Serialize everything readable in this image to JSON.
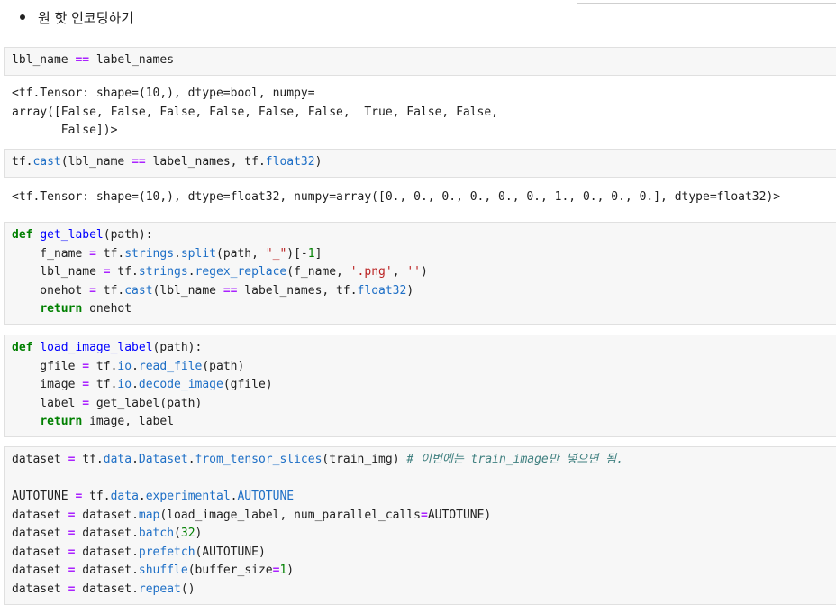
{
  "bullet": {
    "text": "원 핫 인코딩하기"
  },
  "cells": [
    {
      "lines": [
        [
          [
            "t",
            "lbl_name "
          ],
          [
            "op",
            "=="
          ],
          [
            "t",
            " label_names"
          ]
        ]
      ]
    },
    {
      "lines": [
        [
          [
            "t",
            "tf."
          ],
          [
            "attr",
            "cast"
          ],
          [
            "t",
            "(lbl_name "
          ],
          [
            "op",
            "=="
          ],
          [
            "t",
            " label_names, tf."
          ],
          [
            "attr",
            "float32"
          ],
          [
            "t",
            ")"
          ]
        ]
      ]
    },
    {
      "lines": [
        [
          [
            "kw",
            "def"
          ],
          [
            "t",
            " "
          ],
          [
            "fn",
            "get_label"
          ],
          [
            "t",
            "(path):"
          ]
        ],
        [
          [
            "t",
            "    f_name "
          ],
          [
            "op",
            "="
          ],
          [
            "t",
            " tf."
          ],
          [
            "attr",
            "strings"
          ],
          [
            "t",
            "."
          ],
          [
            "attr",
            "split"
          ],
          [
            "t",
            "(path, "
          ],
          [
            "str",
            "\"_\""
          ],
          [
            "t",
            ")[-"
          ],
          [
            "num",
            "1"
          ],
          [
            "t",
            "]"
          ]
        ],
        [
          [
            "t",
            "    lbl_name "
          ],
          [
            "op",
            "="
          ],
          [
            "t",
            " tf."
          ],
          [
            "attr",
            "strings"
          ],
          [
            "t",
            "."
          ],
          [
            "attr",
            "regex_replace"
          ],
          [
            "t",
            "(f_name, "
          ],
          [
            "str",
            "'.png'"
          ],
          [
            "t",
            ", "
          ],
          [
            "str",
            "''"
          ],
          [
            "t",
            ")"
          ]
        ],
        [
          [
            "t",
            "    onehot "
          ],
          [
            "op",
            "="
          ],
          [
            "t",
            " tf."
          ],
          [
            "attr",
            "cast"
          ],
          [
            "t",
            "(lbl_name "
          ],
          [
            "op",
            "=="
          ],
          [
            "t",
            " label_names, tf."
          ],
          [
            "attr",
            "float32"
          ],
          [
            "t",
            ")"
          ]
        ],
        [
          [
            "t",
            "    "
          ],
          [
            "kw",
            "return"
          ],
          [
            "t",
            " onehot"
          ]
        ]
      ]
    },
    {
      "lines": [
        [
          [
            "kw",
            "def"
          ],
          [
            "t",
            " "
          ],
          [
            "fn",
            "load_image_label"
          ],
          [
            "t",
            "(path):"
          ]
        ],
        [
          [
            "t",
            "    gfile "
          ],
          [
            "op",
            "="
          ],
          [
            "t",
            " tf."
          ],
          [
            "attr",
            "io"
          ],
          [
            "t",
            "."
          ],
          [
            "attr",
            "read_file"
          ],
          [
            "t",
            "(path)"
          ]
        ],
        [
          [
            "t",
            "    image "
          ],
          [
            "op",
            "="
          ],
          [
            "t",
            " tf."
          ],
          [
            "attr",
            "io"
          ],
          [
            "t",
            "."
          ],
          [
            "attr",
            "decode_image"
          ],
          [
            "t",
            "(gfile)"
          ]
        ],
        [
          [
            "t",
            "    label "
          ],
          [
            "op",
            "="
          ],
          [
            "t",
            " get_label(path)"
          ]
        ],
        [
          [
            "t",
            "    "
          ],
          [
            "kw",
            "return"
          ],
          [
            "t",
            " image, label"
          ]
        ]
      ]
    },
    {
      "lines": [
        [
          [
            "t",
            "dataset "
          ],
          [
            "op",
            "="
          ],
          [
            "t",
            " tf."
          ],
          [
            "attr",
            "data"
          ],
          [
            "t",
            "."
          ],
          [
            "attr",
            "Dataset"
          ],
          [
            "t",
            "."
          ],
          [
            "attr",
            "from_tensor_slices"
          ],
          [
            "t",
            "(train_img) "
          ],
          [
            "cmt",
            "# 이번에는 train_image만 넣으면 됨."
          ]
        ],
        [
          [
            "t",
            ""
          ]
        ],
        [
          [
            "t",
            "AUTOTUNE "
          ],
          [
            "op",
            "="
          ],
          [
            "t",
            " tf."
          ],
          [
            "attr",
            "data"
          ],
          [
            "t",
            "."
          ],
          [
            "attr",
            "experimental"
          ],
          [
            "t",
            "."
          ],
          [
            "attr",
            "AUTOTUNE"
          ]
        ],
        [
          [
            "t",
            "dataset "
          ],
          [
            "op",
            "="
          ],
          [
            "t",
            " dataset."
          ],
          [
            "attr",
            "map"
          ],
          [
            "t",
            "(load_image_label, num_parallel_calls"
          ],
          [
            "op",
            "="
          ],
          [
            "t",
            "AUTOTUNE)"
          ]
        ],
        [
          [
            "t",
            "dataset "
          ],
          [
            "op",
            "="
          ],
          [
            "t",
            " dataset."
          ],
          [
            "attr",
            "batch"
          ],
          [
            "t",
            "("
          ],
          [
            "num",
            "32"
          ],
          [
            "t",
            ")"
          ]
        ],
        [
          [
            "t",
            "dataset "
          ],
          [
            "op",
            "="
          ],
          [
            "t",
            " dataset."
          ],
          [
            "attr",
            "prefetch"
          ],
          [
            "t",
            "(AUTOTUNE)"
          ]
        ],
        [
          [
            "t",
            "dataset "
          ],
          [
            "op",
            "="
          ],
          [
            "t",
            " dataset."
          ],
          [
            "attr",
            "shuffle"
          ],
          [
            "t",
            "(buffer_size"
          ],
          [
            "op",
            "="
          ],
          [
            "num",
            "1"
          ],
          [
            "t",
            ")"
          ]
        ],
        [
          [
            "t",
            "dataset "
          ],
          [
            "op",
            "="
          ],
          [
            "t",
            " dataset."
          ],
          [
            "attr",
            "repeat"
          ],
          [
            "t",
            "()"
          ]
        ]
      ]
    }
  ],
  "outputs": [
    {
      "lines": [
        "<tf.Tensor: shape=(10,), dtype=bool, numpy=",
        "array([False, False, False, False, False, False,  True, False, False,",
        "       False])>"
      ]
    },
    {
      "lines": [
        "<tf.Tensor: shape=(10,), dtype=float32, numpy=array([0., 0., 0., 0., 0., 0., 1., 0., 0., 0.], dtype=float32)>"
      ]
    }
  ]
}
